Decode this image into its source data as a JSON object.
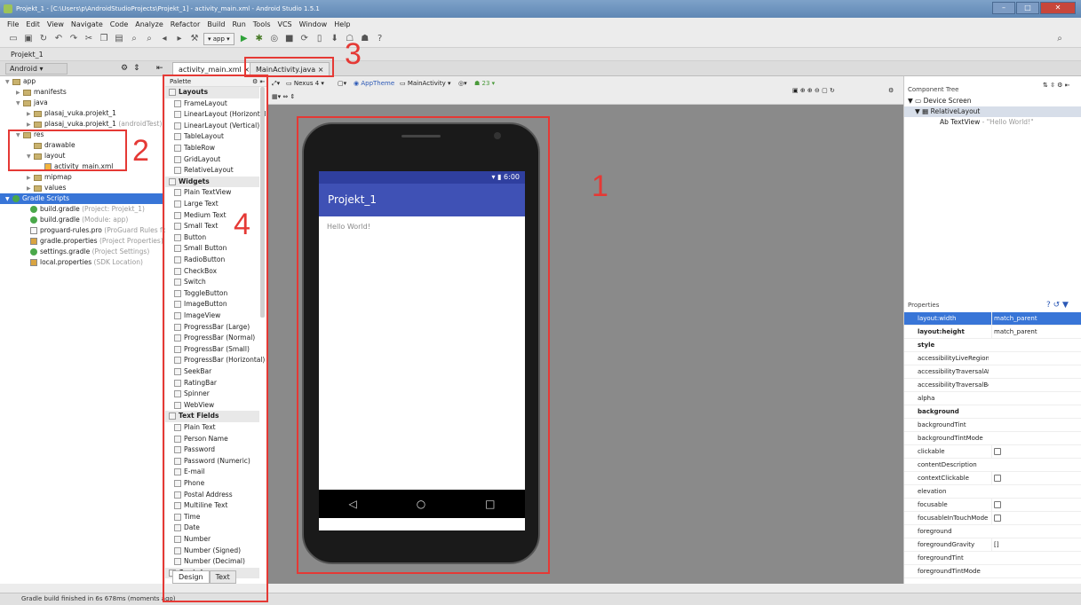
{
  "window": {
    "title": "Projekt_1 - [C:\\Users\\p\\AndroidStudioProjects\\Projekt_1] - activity_main.xml - Android Studio 1.5.1"
  },
  "menu": [
    "File",
    "Edit",
    "View",
    "Navigate",
    "Code",
    "Analyze",
    "Refactor",
    "Build",
    "Run",
    "Tools",
    "VCS",
    "Window",
    "Help"
  ],
  "toolbar": {
    "run_config": "app",
    "help_label": "?"
  },
  "breadcrumb": "Projekt_1",
  "project_selector": "Android",
  "editor_tabs": [
    {
      "label": "activity_main.xml",
      "active": true
    },
    {
      "label": "MainActivity.java",
      "active": false
    }
  ],
  "project_tree": [
    {
      "label": "app",
      "extra": ""
    },
    {
      "label": "manifests",
      "extra": ""
    },
    {
      "label": "java",
      "extra": ""
    },
    {
      "label": "plasaj_vuka.projekt_1",
      "extra": ""
    },
    {
      "label": "plasaj_vuka.projekt_1",
      "extra": "(androidTest)"
    },
    {
      "label": "res",
      "extra": ""
    },
    {
      "label": "drawable",
      "extra": ""
    },
    {
      "label": "layout",
      "extra": ""
    },
    {
      "label": "activity_main.xml",
      "extra": ""
    },
    {
      "label": "mipmap",
      "extra": ""
    },
    {
      "label": "values",
      "extra": ""
    },
    {
      "label": "Gradle Scripts",
      "extra": ""
    },
    {
      "label": "build.gradle",
      "extra": "(Project: Projekt_1)"
    },
    {
      "label": "build.gradle",
      "extra": "(Module: app)"
    },
    {
      "label": "proguard-rules.pro",
      "extra": "(ProGuard Rules for ap"
    },
    {
      "label": "gradle.properties",
      "extra": "(Project Properties)"
    },
    {
      "label": "settings.gradle",
      "extra": "(Project Settings)"
    },
    {
      "label": "local.properties",
      "extra": "(SDK Location)"
    }
  ],
  "palette": {
    "title": "Palette",
    "items": [
      {
        "label": "Layouts",
        "cat": true
      },
      {
        "label": "FrameLayout"
      },
      {
        "label": "LinearLayout (Horizontal)"
      },
      {
        "label": "LinearLayout (Vertical)"
      },
      {
        "label": "TableLayout"
      },
      {
        "label": "TableRow"
      },
      {
        "label": "GridLayout"
      },
      {
        "label": "RelativeLayout"
      },
      {
        "label": "Widgets",
        "cat": true
      },
      {
        "label": "Plain TextView"
      },
      {
        "label": "Large Text"
      },
      {
        "label": "Medium Text"
      },
      {
        "label": "Small Text"
      },
      {
        "label": "Button"
      },
      {
        "label": "Small Button"
      },
      {
        "label": "RadioButton"
      },
      {
        "label": "CheckBox"
      },
      {
        "label": "Switch"
      },
      {
        "label": "ToggleButton"
      },
      {
        "label": "ImageButton"
      },
      {
        "label": "ImageView"
      },
      {
        "label": "ProgressBar (Large)"
      },
      {
        "label": "ProgressBar (Normal)"
      },
      {
        "label": "ProgressBar (Small)"
      },
      {
        "label": "ProgressBar (Horizontal)"
      },
      {
        "label": "SeekBar"
      },
      {
        "label": "RatingBar"
      },
      {
        "label": "Spinner"
      },
      {
        "label": "WebView"
      },
      {
        "label": "Text Fields",
        "cat": true
      },
      {
        "label": "Plain Text"
      },
      {
        "label": "Person Name"
      },
      {
        "label": "Password"
      },
      {
        "label": "Password (Numeric)"
      },
      {
        "label": "E-mail"
      },
      {
        "label": "Phone"
      },
      {
        "label": "Postal Address"
      },
      {
        "label": "Multiline Text"
      },
      {
        "label": "Time"
      },
      {
        "label": "Date"
      },
      {
        "label": "Number"
      },
      {
        "label": "Number (Signed)"
      },
      {
        "label": "Number (Decimal)"
      },
      {
        "label": "Containers",
        "cat": true
      }
    ],
    "tabs": [
      "Design",
      "Text"
    ]
  },
  "editor_toolbar": {
    "device": "Nexus 4",
    "theme": "AppTheme",
    "activity": "MainActivity",
    "api": "23"
  },
  "phone": {
    "time": "6:00",
    "app_title": "Projekt_1",
    "hello": "Hello World!"
  },
  "component_tree": {
    "title": "Component Tree",
    "items": [
      "Device Screen",
      "RelativeLayout",
      "TextView",
      "- \"Hello World!\""
    ]
  },
  "properties": {
    "title": "Properties",
    "rows": [
      {
        "name": "layout:width",
        "value": "match_parent",
        "sel": true
      },
      {
        "name": "layout:height",
        "value": "match_parent",
        "bold": true
      },
      {
        "name": "style",
        "value": "",
        "bold": true
      },
      {
        "name": "accessibilityLiveRegion",
        "value": ""
      },
      {
        "name": "accessibilityTraversalAfte",
        "value": ""
      },
      {
        "name": "accessibilityTraversalBefo",
        "value": ""
      },
      {
        "name": "alpha",
        "value": ""
      },
      {
        "name": "background",
        "value": "",
        "bold": true
      },
      {
        "name": "backgroundTint",
        "value": ""
      },
      {
        "name": "backgroundTintMode",
        "value": ""
      },
      {
        "name": "clickable",
        "value": "",
        "checkbox": true
      },
      {
        "name": "contentDescription",
        "value": ""
      },
      {
        "name": "contextClickable",
        "value": "",
        "checkbox": true
      },
      {
        "name": "elevation",
        "value": ""
      },
      {
        "name": "focusable",
        "value": "",
        "checkbox": true
      },
      {
        "name": "focusableInTouchMode",
        "value": "",
        "checkbox": true
      },
      {
        "name": "foreground",
        "value": ""
      },
      {
        "name": "foregroundGravity",
        "value": "[]"
      },
      {
        "name": "foregroundTint",
        "value": ""
      },
      {
        "name": "foregroundTintMode",
        "value": ""
      }
    ]
  },
  "status": "Gradle build finished in 6s 678ms (moments ago)",
  "annotations": [
    "1",
    "2",
    "3",
    "4"
  ],
  "colors": {
    "accent": "#3f51b5",
    "highlight": "#e53935",
    "selection": "#3875d7"
  }
}
